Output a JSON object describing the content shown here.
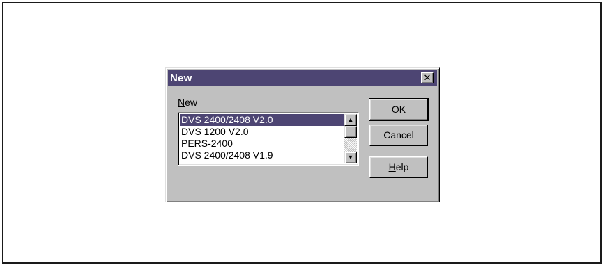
{
  "window": {
    "title": "New"
  },
  "list": {
    "label_prefix": "N",
    "label_rest": "ew",
    "items": [
      {
        "label": "DVS 2400/2408 V2.0",
        "selected": true
      },
      {
        "label": "DVS 1200 V2.0",
        "selected": false
      },
      {
        "label": "PERS-2400",
        "selected": false
      },
      {
        "label": "DVS 2400/2408 V1.9",
        "selected": false
      }
    ]
  },
  "buttons": {
    "ok": "OK",
    "cancel": "Cancel",
    "help_prefix": "H",
    "help_rest": "elp"
  },
  "icons": {
    "close": "close-icon",
    "scroll_up": "scroll-up-icon",
    "scroll_down": "scroll-down-icon"
  },
  "colors": {
    "titlebar": "#4d4573",
    "selection": "#4d4573",
    "dialog_bg": "#c0c0c0"
  }
}
